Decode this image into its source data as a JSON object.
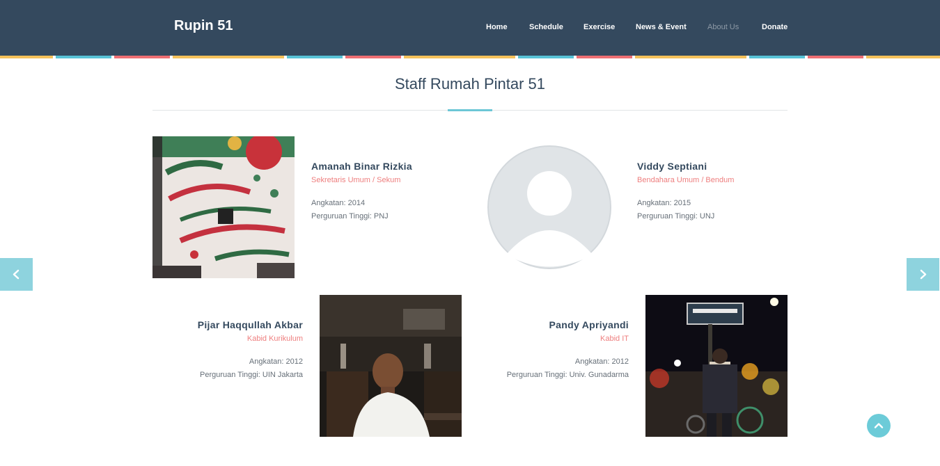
{
  "header": {
    "brand": "Rupin 51",
    "nav": [
      {
        "label": "Home"
      },
      {
        "label": "Schedule"
      },
      {
        "label": "Exercise"
      },
      {
        "label": "News & Event"
      },
      {
        "label": "About Us",
        "active": true
      },
      {
        "label": "Donate"
      }
    ],
    "stripe_colors": [
      "#f5c15a",
      "#57c2d6",
      "#ee6e73"
    ]
  },
  "section": {
    "title": "Staff Rumah Pintar 51"
  },
  "staff": [
    {
      "name": "Amanah Binar Rizkia",
      "role": "Sekretaris Umum / Sekum",
      "angkatan": "Angkatan: 2014",
      "perguruan": "Perguruan Tinggi: PNJ",
      "photo": "motivational-lettering-photo"
    },
    {
      "name": "Viddy Septiani",
      "role": "Bendahara Umum / Bendum",
      "angkatan": "Angkatan: 2015",
      "perguruan": "Perguruan Tinggi: UNJ",
      "photo": "default-avatar"
    },
    {
      "name": "Pijar Haqqullah Akbar",
      "role": "Kabid Kurikulum",
      "angkatan": "Angkatan: 2012",
      "perguruan": "Perguruan Tinggi: UIN Jakarta",
      "photo": "restaurant-portrait-photo"
    },
    {
      "name": "Pandy Apriyandi",
      "role": "Kabid IT",
      "angkatan": "Angkatan: 2012",
      "perguruan": "Perguruan Tinggi: Univ. Gunadarma",
      "photo": "malioboro-night-photo"
    }
  ],
  "controls": {
    "prev_icon": "chevron-left-icon",
    "next_icon": "chevron-right-icon",
    "top_icon": "chevron-up-icon"
  },
  "colors": {
    "header_bg": "#34495e",
    "accent": "#6cc7d6",
    "role_text": "#ee7e7e"
  }
}
